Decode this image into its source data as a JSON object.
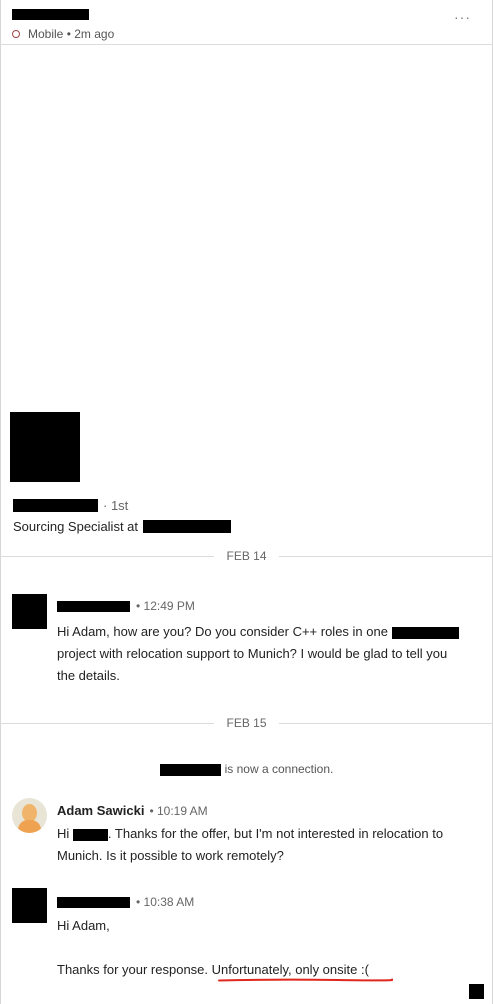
{
  "header": {
    "status": "Mobile",
    "time": "2m ago",
    "more": "···",
    "status_icon": "presence-dot-icon",
    "accent": "#a04848"
  },
  "profile": {
    "degree": "· 1st",
    "title_prefix": "Sourcing Specialist at"
  },
  "dividers": {
    "first": "FEB 14",
    "second": "FEB 15"
  },
  "messages": [
    {
      "time": "• 12:49 PM",
      "line1": "Hi Adam, how are you? Do you consider C++ roles in one",
      "line2": "project with relocation support to Munich? I would be glad to tell you",
      "line3": "the details."
    },
    {
      "sender": "Adam Sawicki",
      "time": "• 10:19 AM",
      "greeting": "Hi",
      "line1_rest": ". Thanks for the offer, but I'm not interested in relocation to",
      "line2": "Munich. Is it possible to work remotely?"
    },
    {
      "time": "• 10:38 AM",
      "line1": "Hi Adam,",
      "line2_a": "Thanks for your response. ",
      "line2_b": "Unfortunately, only onsite :("
    }
  ],
  "connection_text": "is now a connection.",
  "highlight_color": "#e0261d"
}
